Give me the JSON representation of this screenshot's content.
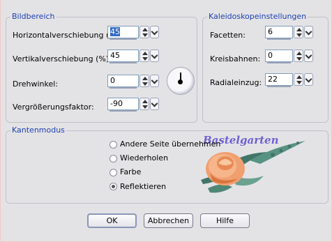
{
  "bildbereich": {
    "title": "Bildbereich",
    "horizontal": {
      "label": "Horizontalverschiebung (%):",
      "value": "45"
    },
    "vertikal": {
      "label": "Vertikalverschiebung (%):",
      "value": "45"
    },
    "drehwinkel": {
      "label": "Drehwinkel:",
      "value": "0"
    },
    "vergroesserung": {
      "label": "Vergrößerungsfaktor:",
      "value": "-90"
    }
  },
  "kaleidoskop": {
    "title": "Kaleidoskopeinstellungen",
    "facetten": {
      "label": "Facetten:",
      "value": "6"
    },
    "kreisbahnen": {
      "label": "Kreisbahnen:",
      "value": "0"
    },
    "radialeinzug": {
      "label": "Radialeinzug:",
      "value": "22"
    }
  },
  "kantenmodus": {
    "title": "Kantenmodus",
    "options": [
      {
        "label": "Andere Seite übernehmen",
        "checked": false
      },
      {
        "label": "Wiederholen",
        "checked": false
      },
      {
        "label": "Farbe",
        "checked": false
      },
      {
        "label": "Reflektieren",
        "checked": true
      }
    ]
  },
  "watermark": {
    "text": "Bastelgarten"
  },
  "buttons": {
    "ok": "OK",
    "cancel": "Abbrechen",
    "help": "Hilfe"
  },
  "colors": {
    "group_title": "#1c3fb0",
    "selection": "#316ac5"
  }
}
